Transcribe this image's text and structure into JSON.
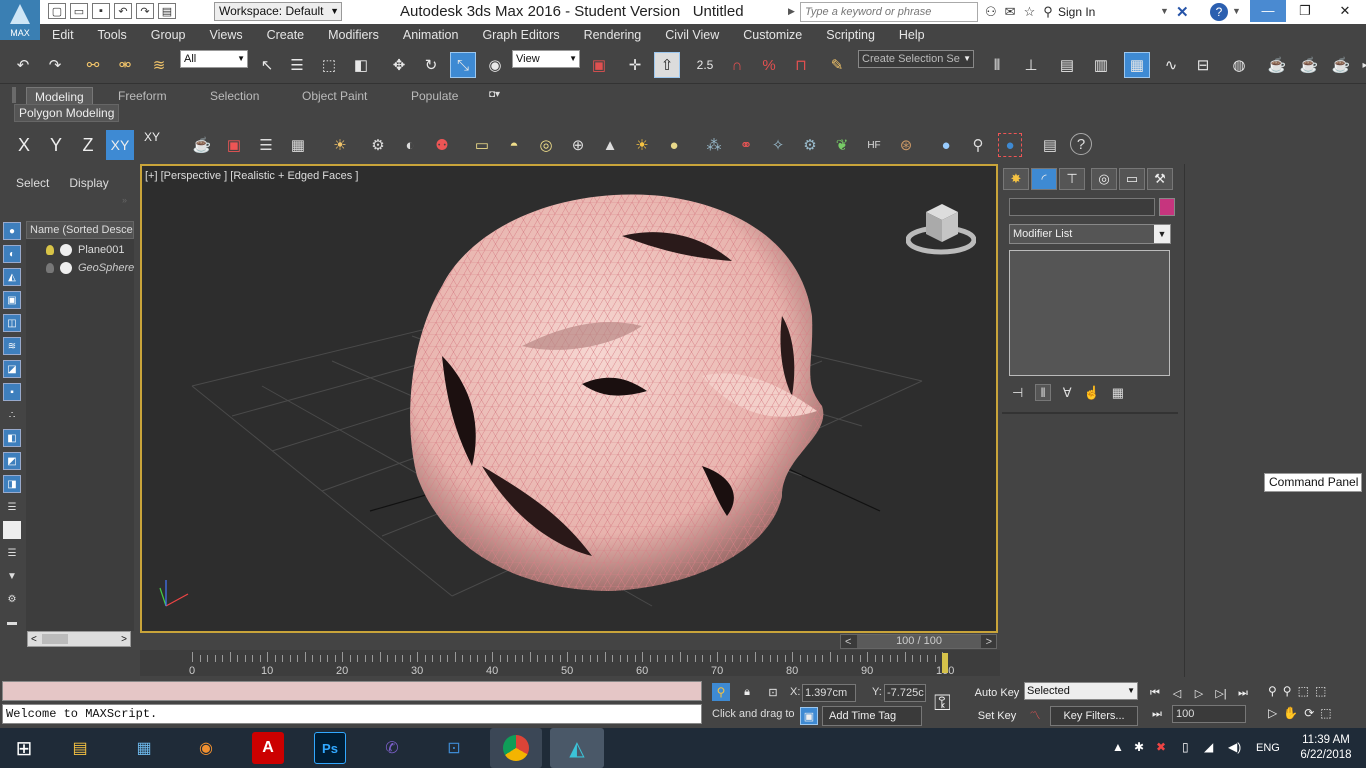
{
  "title_bar": {
    "workspace": "Workspace: Default",
    "title": "Autodesk 3ds Max 2016 - Student Version",
    "document": "Untitled",
    "search_placeholder": "Type a keyword or phrase",
    "sign_in": "Sign In",
    "logo_text": "MAX"
  },
  "menu": [
    "Edit",
    "Tools",
    "Group",
    "Views",
    "Create",
    "Modifiers",
    "Animation",
    "Graph Editors",
    "Rendering",
    "Civil View",
    "Customize",
    "Scripting",
    "Help"
  ],
  "main_toolbar": {
    "filter_value": "All",
    "ref_coord": "View",
    "snap_value": "2.5",
    "selection_set_placeholder": "Create Selection Se"
  },
  "ribbon": {
    "tabs": [
      "Modeling",
      "Freeform",
      "Selection",
      "Object Paint",
      "Populate"
    ],
    "active_tab": "Modeling",
    "panel": "Polygon Modeling"
  },
  "axis_buttons": [
    "X",
    "Y",
    "Z",
    "XY",
    "XY"
  ],
  "scene_explorer": {
    "tabs": [
      "Select",
      "Display"
    ],
    "column_header": "Name (Sorted Descen",
    "objects": [
      {
        "name": "Plane001"
      },
      {
        "name": "GeoSphere"
      }
    ]
  },
  "viewport": {
    "label": "[+] [Perspective ] [Realistic + Edged Faces ]"
  },
  "timeline": {
    "frame_display": "100 / 100",
    "labels": [
      "0",
      "10",
      "20",
      "30",
      "40",
      "50",
      "60",
      "70",
      "80",
      "90",
      "100"
    ]
  },
  "command_panel": {
    "modifier_list": "Modifier List",
    "tooltip": "Command Panel"
  },
  "status": {
    "maxscript_output": "Welcome to MAXScript.",
    "prompt": "Click and drag to",
    "add_time_tag": "Add Time Tag",
    "x_label": "X:",
    "x_value": "1.397cm",
    "y_label": "Y:",
    "y_value": "-7.725c",
    "auto_key": "Auto Key",
    "set_key": "Set Key",
    "selected": "Selected",
    "key_filters": "Key Filters...",
    "frame": "100"
  },
  "taskbar": {
    "lang": "ENG",
    "time": "11:39 AM",
    "date": "6/22/2018"
  },
  "colors": {
    "accent": "#3e8ad3",
    "viewport_border": "#c9a43a",
    "mesh": "#f1c5c0",
    "object_color": "#c6357e"
  }
}
